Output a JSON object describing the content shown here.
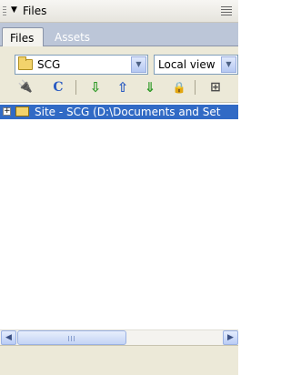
{
  "panel": {
    "title": "Files"
  },
  "tabs": [
    {
      "label": "Files",
      "active": true
    },
    {
      "label": "Assets",
      "active": false
    }
  ],
  "site_select": {
    "value": "SCG"
  },
  "view_select": {
    "value": "Local view"
  },
  "toolbar": {
    "connect_icon": "🔌",
    "refresh_icon": "C",
    "get_icon": "⇩",
    "put_icon": "⇧",
    "checkout_icon": "⇓",
    "checkin_icon": "🔒",
    "expand_icon": "⊞"
  },
  "tree": [
    {
      "label": "Site - SCG (D:\\Documents and Set",
      "expander": "+"
    }
  ],
  "scrollbar": {
    "left_arrow": "◀",
    "right_arrow": "▶"
  },
  "colors": {
    "selection": "#316ac5",
    "tab_strip": "#bcc6d8",
    "toolbar_bg": "#ece9d8"
  }
}
